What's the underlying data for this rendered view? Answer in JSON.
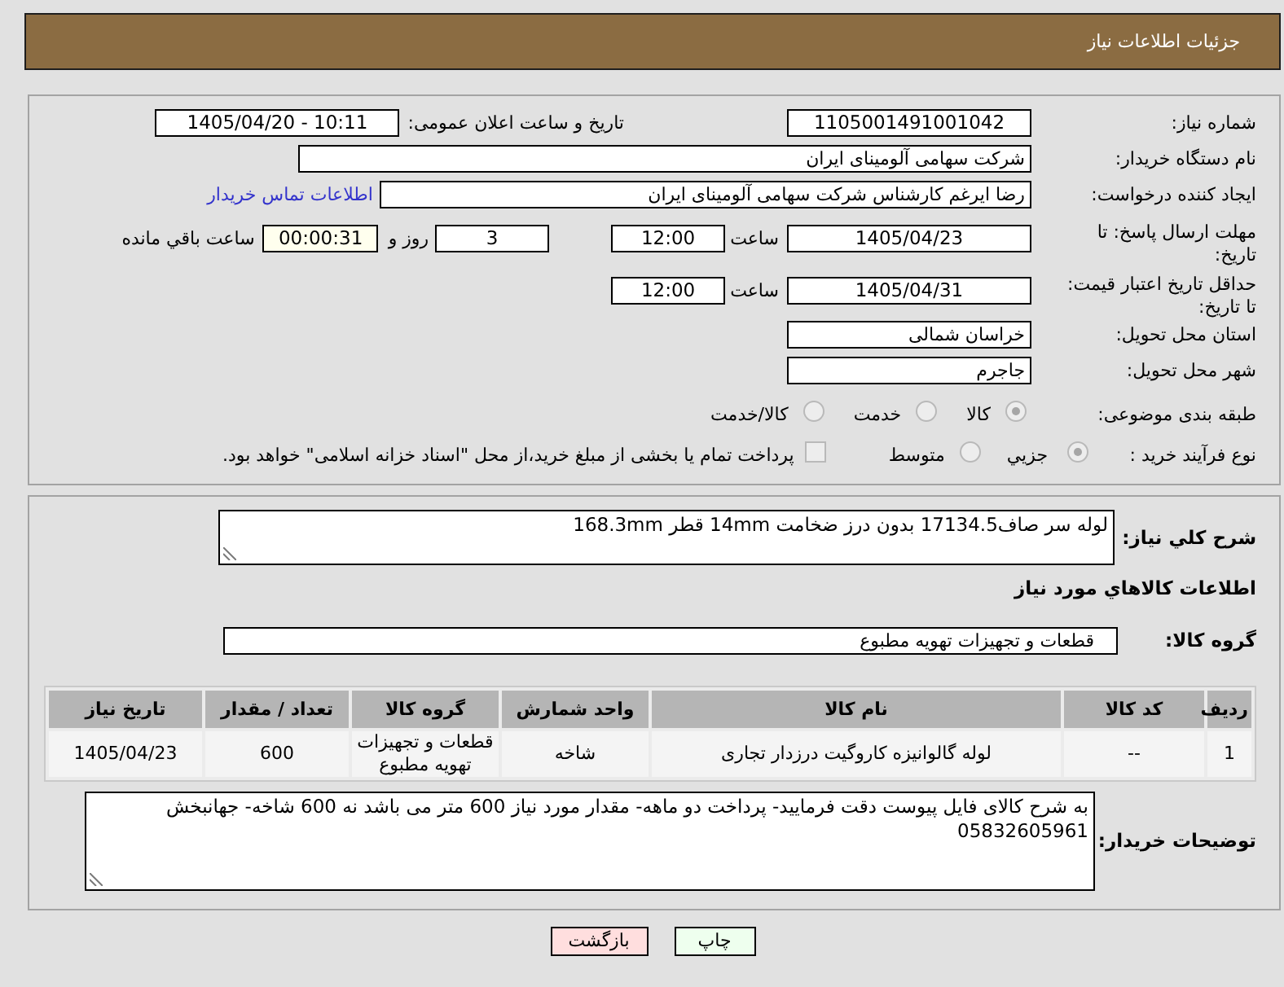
{
  "header": {
    "title": "جزئیات اطلاعات نیاز"
  },
  "details": {
    "need_number": {
      "label": "شماره نیاز:",
      "value": "1105001491001042"
    },
    "announcement": {
      "label": "تاریخ و ساعت اعلان عمومی:",
      "value": "1405/04/20 - 10:11"
    },
    "buyer_org": {
      "label": "نام دستگاه خریدار:",
      "value": "شرکت سهامی آلومینای ایران"
    },
    "requester": {
      "label": "ایجاد کننده درخواست:",
      "value": "رضا ایرغم کارشناس شرکت سهامی آلومینای ایران",
      "contact_link": "اطلاعات تماس خریدار"
    },
    "response_deadline": {
      "label": "مهلت ارسال پاسخ: تا تاریخ:",
      "date": "1405/04/23",
      "time_label": "ساعت",
      "time": "12:00",
      "days": "3",
      "days_label": "روز و",
      "remaining": "00:00:31",
      "remaining_label": "ساعت باقي مانده"
    },
    "price_validity": {
      "label": "حداقل تاریخ اعتبار قیمت: تا تاریخ:",
      "date": "1405/04/31",
      "time_label": "ساعت",
      "time": "12:00"
    },
    "delivery_province": {
      "label": "استان محل تحویل:",
      "value": "خراسان شمالی"
    },
    "delivery_city": {
      "label": "شهر محل تحویل:",
      "value": "جاجرم"
    },
    "category": {
      "label": "طبقه بندی موضوعی:",
      "options": [
        {
          "label": "کالا",
          "selected": true
        },
        {
          "label": "خدمت",
          "selected": false
        },
        {
          "label": "کالا/خدمت",
          "selected": false
        }
      ]
    },
    "purchase_process": {
      "label": "نوع فرآیند خرید :",
      "options": [
        {
          "label": "جزيي",
          "selected": true
        },
        {
          "label": "متوسط",
          "selected": false
        }
      ],
      "treasury_option": {
        "label": "پرداخت تمام یا بخشی از مبلغ خرید،از محل \"اسناد خزانه اسلامی\" خواهد بود.",
        "checked": false
      }
    }
  },
  "items": {
    "description": {
      "label": "شرح کلي نیاز:",
      "value": "لوله سر صاف17134.5 بدون درز ضخامت 14mm قطر 168.3mm"
    },
    "section_title": "اطلاعات کالاهاي مورد نیاز",
    "goods_group": {
      "label": "گروه کالا:",
      "value": "قطعات و تجهیزات تهویه مطبوع"
    },
    "table": {
      "columns": [
        "ردیف",
        "کد کالا",
        "نام کالا",
        "واحد شمارش",
        "گروه کالا",
        "تعداد / مقدار",
        "تاریخ نیاز"
      ],
      "rows": [
        [
          "1",
          "--",
          "لوله گالوانیزه کاروگیت درزدار تجاری",
          "شاخه",
          "قطعات و تجهیزات تهویه مطبوع",
          "600",
          "1405/04/23"
        ]
      ]
    },
    "buyer_notes": {
      "label": "توضیحات خریدار:",
      "value": "به شرح کالای فایل پیوست دقت فرمایید- پرداخت دو ماهه- مقدار مورد نیاز 600 متر می باشد نه 600 شاخه- جهانبخش 05832605961"
    }
  },
  "buttons": [
    {
      "label": "چاپ",
      "kind": "print"
    },
    {
      "label": "بازگشت",
      "kind": "back"
    }
  ]
}
